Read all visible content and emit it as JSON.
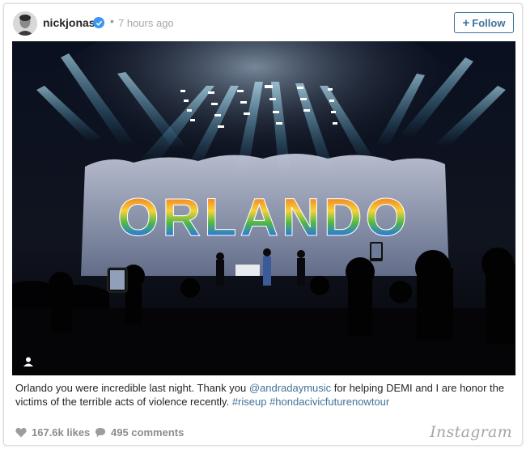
{
  "post": {
    "username": "nickjonas",
    "separator": "•",
    "timestamp": "7 hours ago",
    "follow_label": "Follow",
    "follow_plus": "+"
  },
  "photo": {
    "banner_text": "ORLANDO",
    "banner_colors": [
      "#e94b3c",
      "#f28c28",
      "#f6d23a",
      "#4fb848",
      "#2e7bd6",
      "#7b4fc4"
    ]
  },
  "caption": {
    "part1": "Orlando you were incredible last night. Thank you ",
    "mention": "@andradaymusic",
    "part2": " for helping DEMI and I are honor the victims of the terrible acts of violence recently. ",
    "hashtag1": "#riseup",
    "space": " ",
    "hashtag2": "#hondacivicfuturenowtour"
  },
  "footer": {
    "likes": "167.6k likes",
    "comments": "495 comments",
    "brand": "Instagram"
  },
  "colors": {
    "link": "#3f729b",
    "verified": "#3897f0",
    "muted": "#a5a7aa"
  }
}
